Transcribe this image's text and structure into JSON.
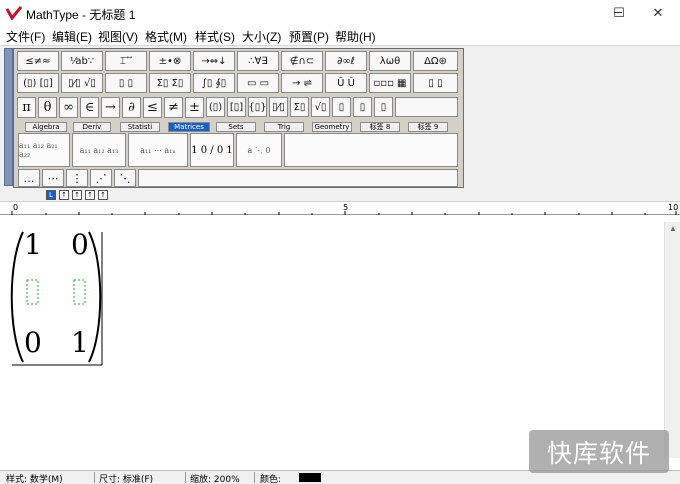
{
  "window": {
    "title": "MathType - 无标题 1",
    "controls": {
      "minimize": "─",
      "maximize": "☐",
      "close": "✕"
    }
  },
  "menu": {
    "items": [
      {
        "label": "文件(F)"
      },
      {
        "label": "编辑(E)"
      },
      {
        "label": "视图(V)"
      },
      {
        "label": "格式(M)"
      },
      {
        "label": "样式(S)"
      },
      {
        "label": "大小(Z)"
      },
      {
        "label": "预置(P)"
      },
      {
        "label": "帮助(H)"
      }
    ]
  },
  "symbol_row": [
    "≤≠≈",
    "⅟ab∵",
    "⌶ ⃗ ⃗",
    "±•⊗",
    "→⇔↓",
    "∴∀∃",
    "∉∩⊂",
    "∂∞ℓ",
    "λωθ",
    "ΔΩ⊛"
  ],
  "template_row": [
    "(▯) [▯]",
    "▯⁄▯ √▯",
    "▯ ▯",
    "Σ▯ Σ▯",
    "∫▯ ∮▯",
    "▭ ▭",
    "→ ⇌",
    "Ū Ǔ",
    "▫▫▫ ▦",
    "▯ ▯"
  ],
  "custom_row": [
    "π",
    "θ",
    "∞",
    "∈",
    "→",
    "∂",
    "≤",
    "≠",
    "±",
    "(▯)",
    "[▯]",
    "{▯}",
    "▯⁄▯",
    "Σ▯",
    "√▯",
    "▯",
    "▯",
    "▯"
  ],
  "tabs": [
    "Algebra",
    "Deriv",
    "Statisti",
    "Matrices",
    "Sets",
    "Trig",
    "Geometry",
    "标签 8",
    "标签 9"
  ],
  "active_tab": "Matrices",
  "matrix_templates": [
    "a₁₁ a₁₂ a₂₁ a₂₂",
    "a₁₁ a₁₂ a₁₃",
    "a₁₁ ⋯ a₁ₙ",
    "1 0 / 0 1",
    "a ⋱ 0"
  ],
  "dots_row": [
    "…",
    "⋯",
    "⋮",
    "⋰",
    "⋱"
  ],
  "size_buttons": [
    "L",
    "↑",
    "↑",
    "↑",
    "↑"
  ],
  "ruler": {
    "marks": [
      "0",
      "5",
      "10"
    ]
  },
  "equation": {
    "m11": "1",
    "m12": "0",
    "m31": "0",
    "m32": "1"
  },
  "status": {
    "style": "样式: 数学(M)",
    "size": "尺寸: 标准(F)",
    "zoom": "缩放: 200%",
    "color_label": "颜色:"
  },
  "watermark": "快库软件",
  "colors": {
    "accent": "#1a5fc4",
    "brand": "#c8102e"
  }
}
